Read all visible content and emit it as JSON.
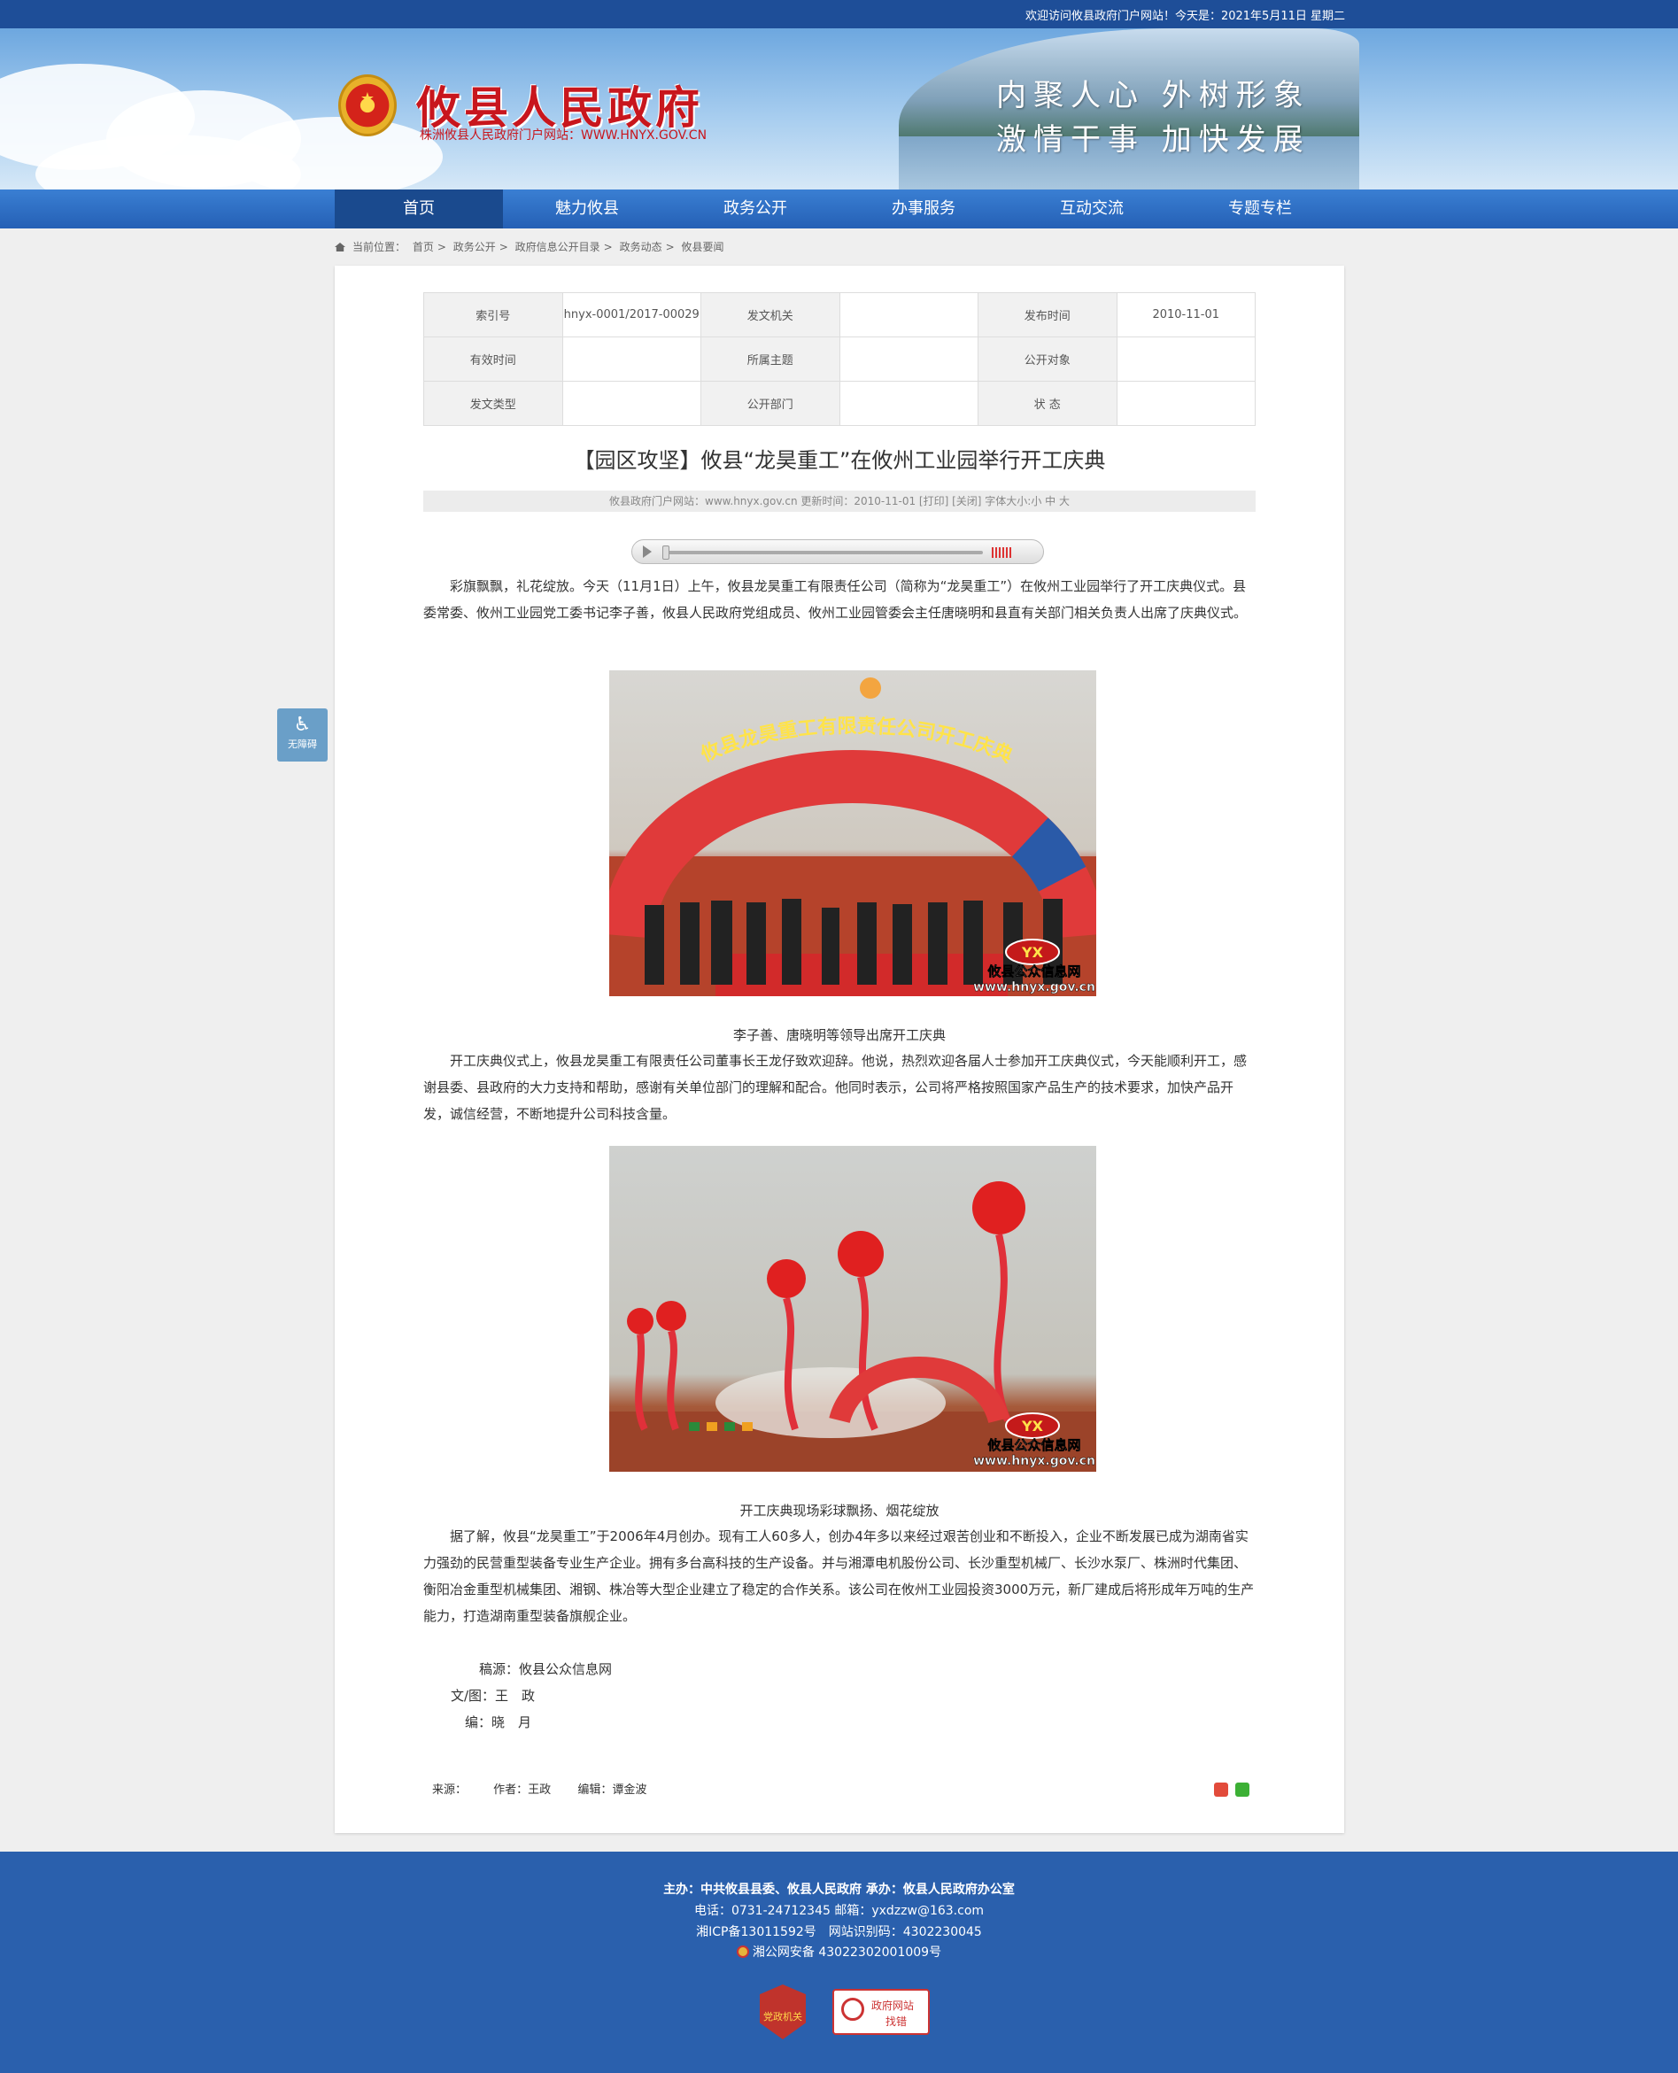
{
  "topbar": {
    "welcome": "欢迎访问攸县政府门户网站！今天是：2021年5月11日 星期二"
  },
  "header": {
    "title": "攸县人民政府",
    "subtitle": "株洲攸县人民政府门户网站：WWW.HNYX.GOV.CN",
    "slogan_line1": "内聚人心  外树形象",
    "slogan_line2": "激情干事  加快发展",
    "emblem_icon": "national-emblem-icon"
  },
  "nav": {
    "items": [
      {
        "label": "首页",
        "active": true
      },
      {
        "label": "魅力攸县"
      },
      {
        "label": "政务公开"
      },
      {
        "label": "办事服务"
      },
      {
        "label": "互动交流"
      },
      {
        "label": "专题专栏"
      }
    ]
  },
  "breadcrumb": {
    "prefix": "当前位置：",
    "items": [
      "首页",
      "政务公开",
      "政府信息公开目录",
      "政务动态",
      "攸县要闻"
    ],
    "separator": ">"
  },
  "meta": {
    "row1": [
      {
        "label": "索引号",
        "value": "hnyx-0001/2017-00029"
      },
      {
        "label": "发文机关",
        "value": ""
      },
      {
        "label": "发布时间",
        "value": "2010-11-01"
      }
    ],
    "row2": [
      {
        "label": "有效时间",
        "value": ""
      },
      {
        "label": "所属主题",
        "value": ""
      },
      {
        "label": "公开对象",
        "value": ""
      }
    ],
    "row3": [
      {
        "label": "发文类型",
        "value": ""
      },
      {
        "label": "公开部门",
        "value": ""
      },
      {
        "label": "状 态",
        "value": ""
      }
    ]
  },
  "article": {
    "title": "【园区攻坚】攸县“龙昊重工”在攸州工业园举行开工庆典",
    "info": "攸县政府门户网站：www.hnyx.gov.cn  更新时间：2010-11-01  [打印]  [关闭]  字体大小:小 中 大",
    "p1": "彩旗飘飘，礼花绽放。今天（11月1日）上午，攸县龙昊重工有限责任公司（简称为“龙昊重工”）在攸州工业园举行了开工庆典仪式。县委常委、攸州工业园党工委书记李子善，攸县人民政府党组成员、攸州工业园管委会主任唐晓明和县直有关部门相关负责人出席了庆典仪式。",
    "photo1": {
      "arch_text": "攸县龙昊重工有限责任公司开工庆典",
      "watermark_line1": "攸县公众信息网",
      "watermark_line2": "www.hnyx.gov.cn",
      "logo": "YX"
    },
    "caption1": "李子善、唐晓明等领导出席开工庆典",
    "p2": "开工庆典仪式上，攸县龙昊重工有限责任公司董事长王龙仔致欢迎辞。他说，热烈欢迎各届人士参加开工庆典仪式，今天能顺利开工，感谢县委、县政府的大力支持和帮助，感谢有关单位部门的理解和配合。他同时表示，公司将严格按照国家产品生产的技术要求，加快产品开发，诚信经营，不断地提升公司科技含量。",
    "photo2": {
      "watermark_line1": "攸县公众信息网",
      "watermark_line2": "www.hnyx.gov.cn",
      "logo": "YX"
    },
    "caption2": "开工庆典现场彩球飘扬、烟花绽放",
    "p3": "据了解，攸县“龙昊重工”于2006年4月创办。现有工人60多人，创办4年多以来经过艰苦创业和不断投入，企业不断发展已成为湖南省实力强劲的民营重型装备专业生产企业。拥有多台高科技的生产设备。并与湘潭电机股份公司、长沙重型机械厂、长沙水泵厂、株洲时代集团、衡阳冶金重型机械集团、湘钢、株冶等大型企业建立了稳定的合作关系。该公司在攸州工业园投资3000万元，新厂建成后将形成年万吨的生产能力，打造湖南重型装备旗舰企业。",
    "credit_source": "稿源：攸县公众信息网",
    "credit_author": "文/图：王　政",
    "credit_editor": "编：晓　月"
  },
  "article_footer": {
    "source": "来源：",
    "author": "作者：王政",
    "editor": "编辑：谭金波"
  },
  "share": {
    "weibo_icon": "weibo-share-icon",
    "wechat_icon": "wechat-share-icon"
  },
  "accessibility": {
    "label": "无障碍",
    "icon": "wheelchair-icon"
  },
  "footer": {
    "line1": "主办：中共攸县县委、攸县人民政府 承办：攸县人民政府办公室",
    "line2": "电话：0731-24712345 邮箱：yxdzzw@163.com",
    "line3": "湘ICP备13011592号　网站识别码：4302230045",
    "line4": "湘公网安备 43022302001009号",
    "badge1": "党政机关",
    "badge2_line1": "政府网站",
    "badge2_line2": "找错"
  },
  "colors": {
    "topbar": "#1e4e98",
    "nav": "#2f6fc4",
    "nav_active": "#1a4a8e",
    "footer": "#2a60ad",
    "title_red": "#c8161d"
  }
}
